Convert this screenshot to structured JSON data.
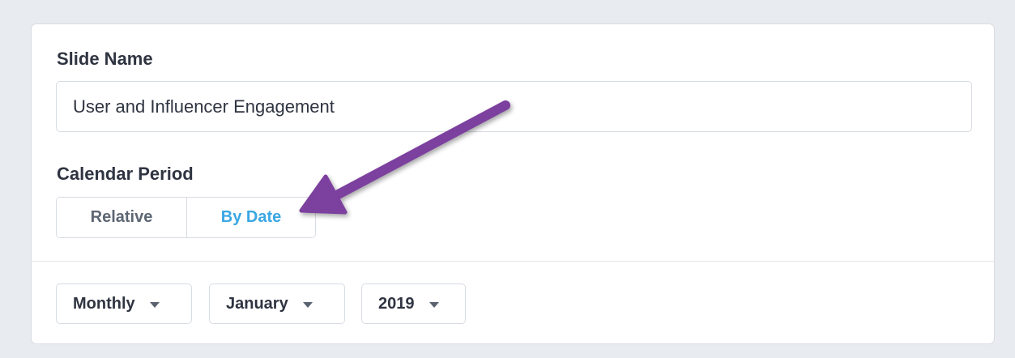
{
  "form": {
    "slide_name_label": "Slide Name",
    "slide_name_value": "User and Influencer Engagement",
    "calendar_period_label": "Calendar Period",
    "calendar_period_options": [
      "Relative",
      "By Date"
    ],
    "calendar_period_selected": "By Date",
    "period_dropdown": "Monthly",
    "month_dropdown": "January",
    "year_dropdown": "2019"
  },
  "colors": {
    "background": "#e8ebf0",
    "card": "#ffffff",
    "selected_toggle_text": "#3aa7e3",
    "annotation_arrow": "#7b3f9e"
  },
  "icons": {
    "dropdown": "caret-down-icon",
    "annotation": "arrow-annotation"
  }
}
